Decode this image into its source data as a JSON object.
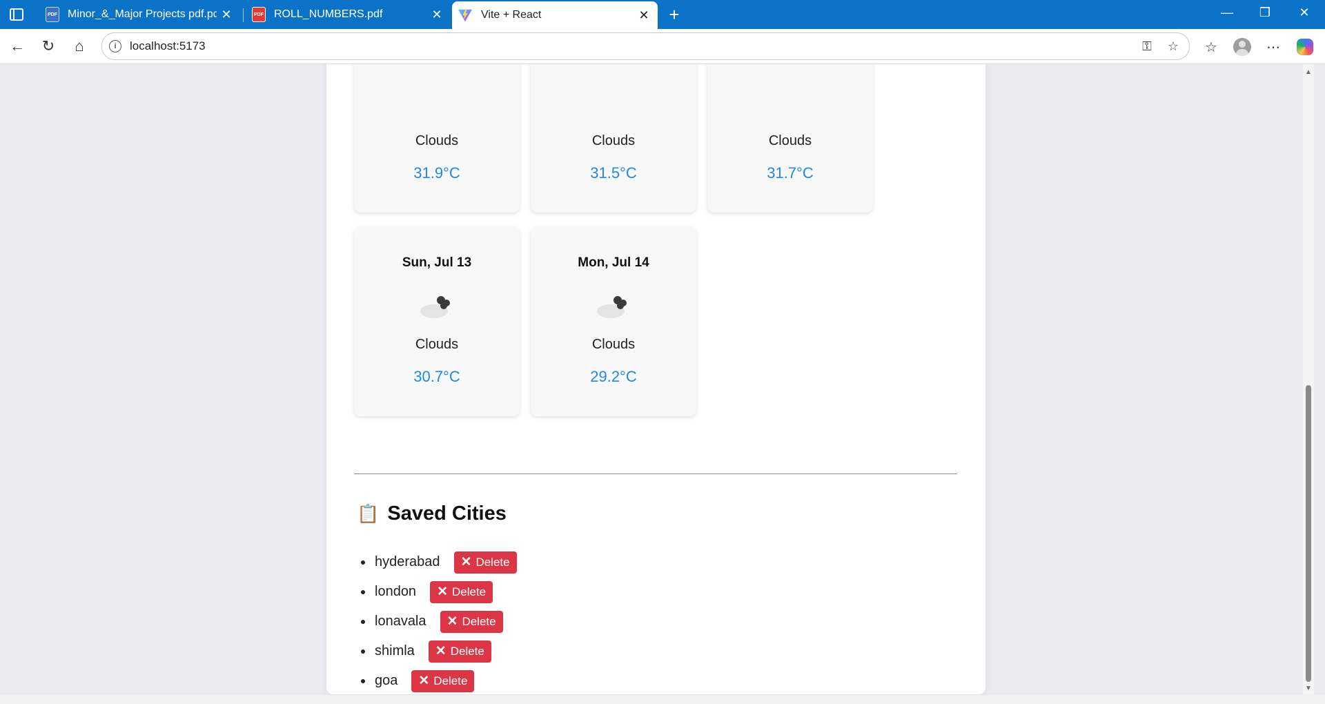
{
  "browser": {
    "tabs": [
      {
        "title": "Minor_&_Major Projects pdf.pdf",
        "icon": "pdf-icon"
      },
      {
        "title": "ROLL_NUMBERS.pdf",
        "icon": "pdf-icon"
      },
      {
        "title": "Vite + React",
        "icon": "vite-logo-icon",
        "active": true
      }
    ],
    "address": "localhost:5173"
  },
  "forecast": [
    {
      "date": "",
      "description": "Clouds",
      "temp": "31.9°C"
    },
    {
      "date": "",
      "description": "Clouds",
      "temp": "31.5°C"
    },
    {
      "date": "",
      "description": "Clouds",
      "temp": "31.7°C"
    },
    {
      "date": "Sun, Jul 13",
      "description": "Clouds",
      "temp": "30.7°C"
    },
    {
      "date": "Mon, Jul 14",
      "description": "Clouds",
      "temp": "29.2°C"
    }
  ],
  "saved": {
    "title": "Saved Cities",
    "icon": "clipboard-icon",
    "delete_label": "Delete",
    "cities": [
      "hyderabad",
      "london",
      "lonavala",
      "shimla",
      "goa"
    ]
  },
  "colors": {
    "accent": "#1e88e5",
    "danger": "#dc3545",
    "tabbar": "#0b73c7"
  }
}
